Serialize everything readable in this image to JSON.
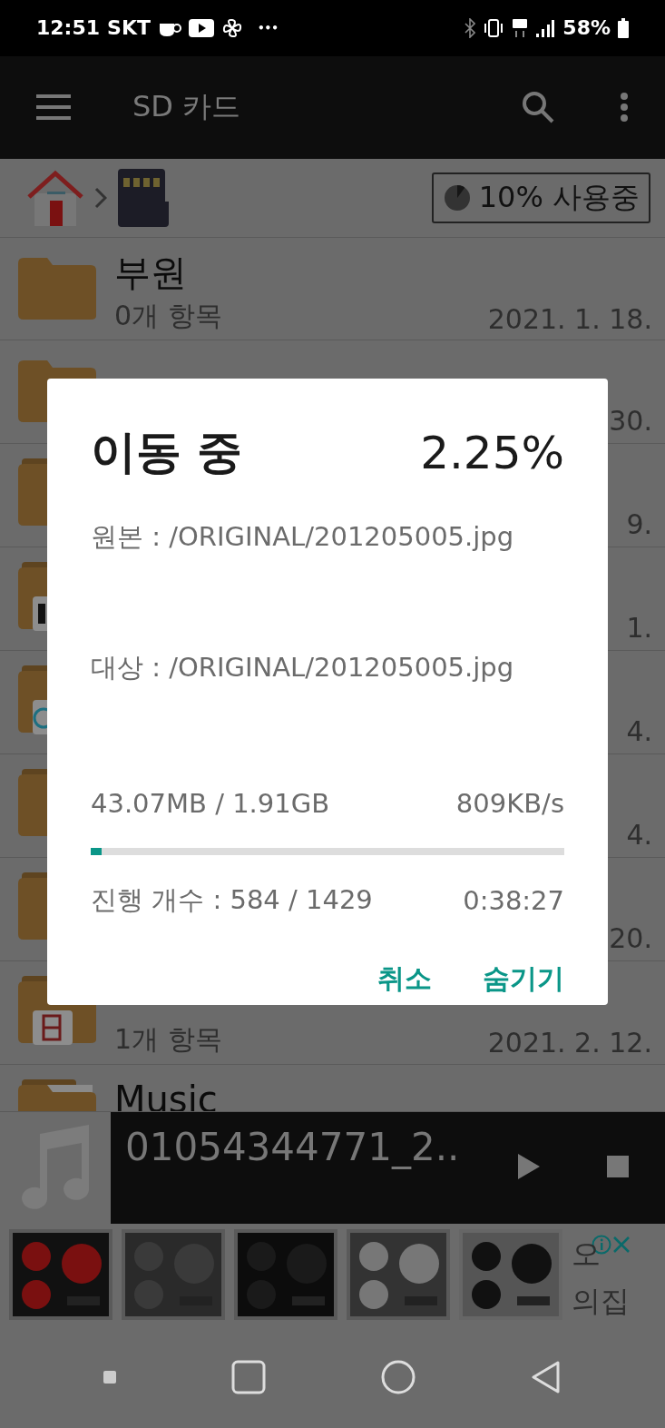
{
  "status_bar": {
    "time": "12:51",
    "carrier": "SKT",
    "overflow": "•••",
    "battery": "58%"
  },
  "app_bar": {
    "title": "SD 카드"
  },
  "breadcrumb": {
    "usage": "10% 사용중",
    "level": 0.1
  },
  "rows": [
    {
      "kind": "folder",
      "name": "부원",
      "count": "0개 항목",
      "date": "2021. 1. 18."
    },
    {
      "kind": "folder",
      "date": "30."
    },
    {
      "kind": "stacked",
      "date": "9."
    },
    {
      "kind": "doc",
      "date": "1."
    },
    {
      "kind": "app",
      "date": "4."
    },
    {
      "kind": "stacked",
      "date": "4."
    },
    {
      "kind": "stacked",
      "date": "20."
    },
    {
      "kind": "video",
      "count": "1개 항목",
      "date": "2021. 2. 12."
    },
    {
      "kind": "stacked",
      "name": "Music"
    }
  ],
  "player": {
    "track": "01054344771_2.."
  },
  "ad": {
    "text_lines": [
      "오",
      "의집"
    ]
  },
  "dialog": {
    "title": "이동 중",
    "percent": "2.25%",
    "source": "원본 : /ORIGINAL/201205005.jpg",
    "target": "대상 : /ORIGINAL/201205005.jpg",
    "size": "43.07MB / 1.91GB",
    "speed": "809KB/s",
    "level": 0.0225,
    "count": "진행 개수 : 584 / 1429",
    "remaining": "0:38:27",
    "buttons": [
      "취소",
      "숨기기"
    ]
  }
}
